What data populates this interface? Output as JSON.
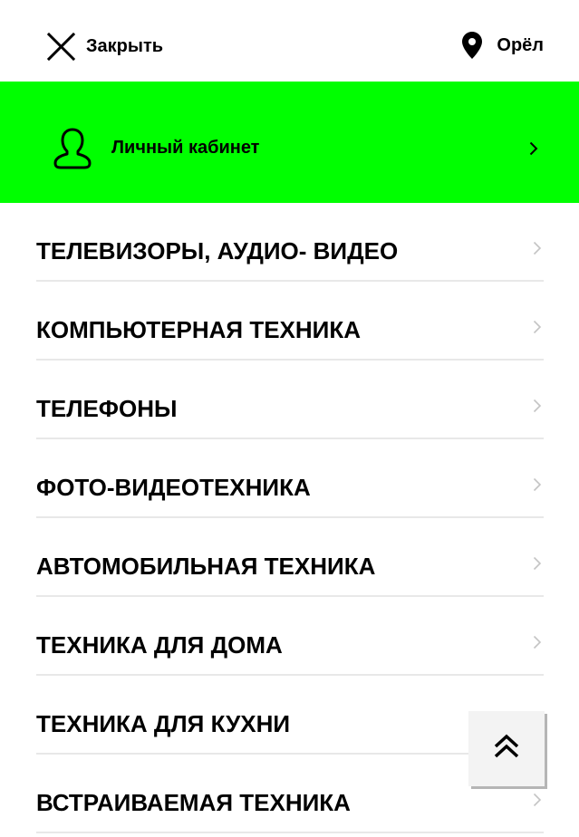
{
  "header": {
    "close_label": "Закрыть",
    "city": "Орёл"
  },
  "account": {
    "label": "Личный кабинет",
    "background_color": "#00ff00"
  },
  "categories": [
    {
      "label": "ТЕЛЕВИЗОРЫ, АУДИО- ВИДЕО"
    },
    {
      "label": "КОМПЬЮТЕРНАЯ ТЕХНИКА"
    },
    {
      "label": "ТЕЛЕФОНЫ"
    },
    {
      "label": "ФОТО-ВИДЕОТЕХНИКА"
    },
    {
      "label": "АВТОМОБИЛЬНАЯ ТЕХНИКА"
    },
    {
      "label": "ТЕХНИКА ДЛЯ ДОМА"
    },
    {
      "label": "ТЕХНИКА ДЛЯ КУХНИ"
    },
    {
      "label": "ВСТРАИВАЕМАЯ ТЕХНИКА"
    }
  ],
  "icons": {
    "close": "close-icon",
    "location": "map-pin-icon",
    "user": "user-icon",
    "chevron": "chevron-right-icon",
    "scroll_top": "double-chevron-up-icon"
  }
}
